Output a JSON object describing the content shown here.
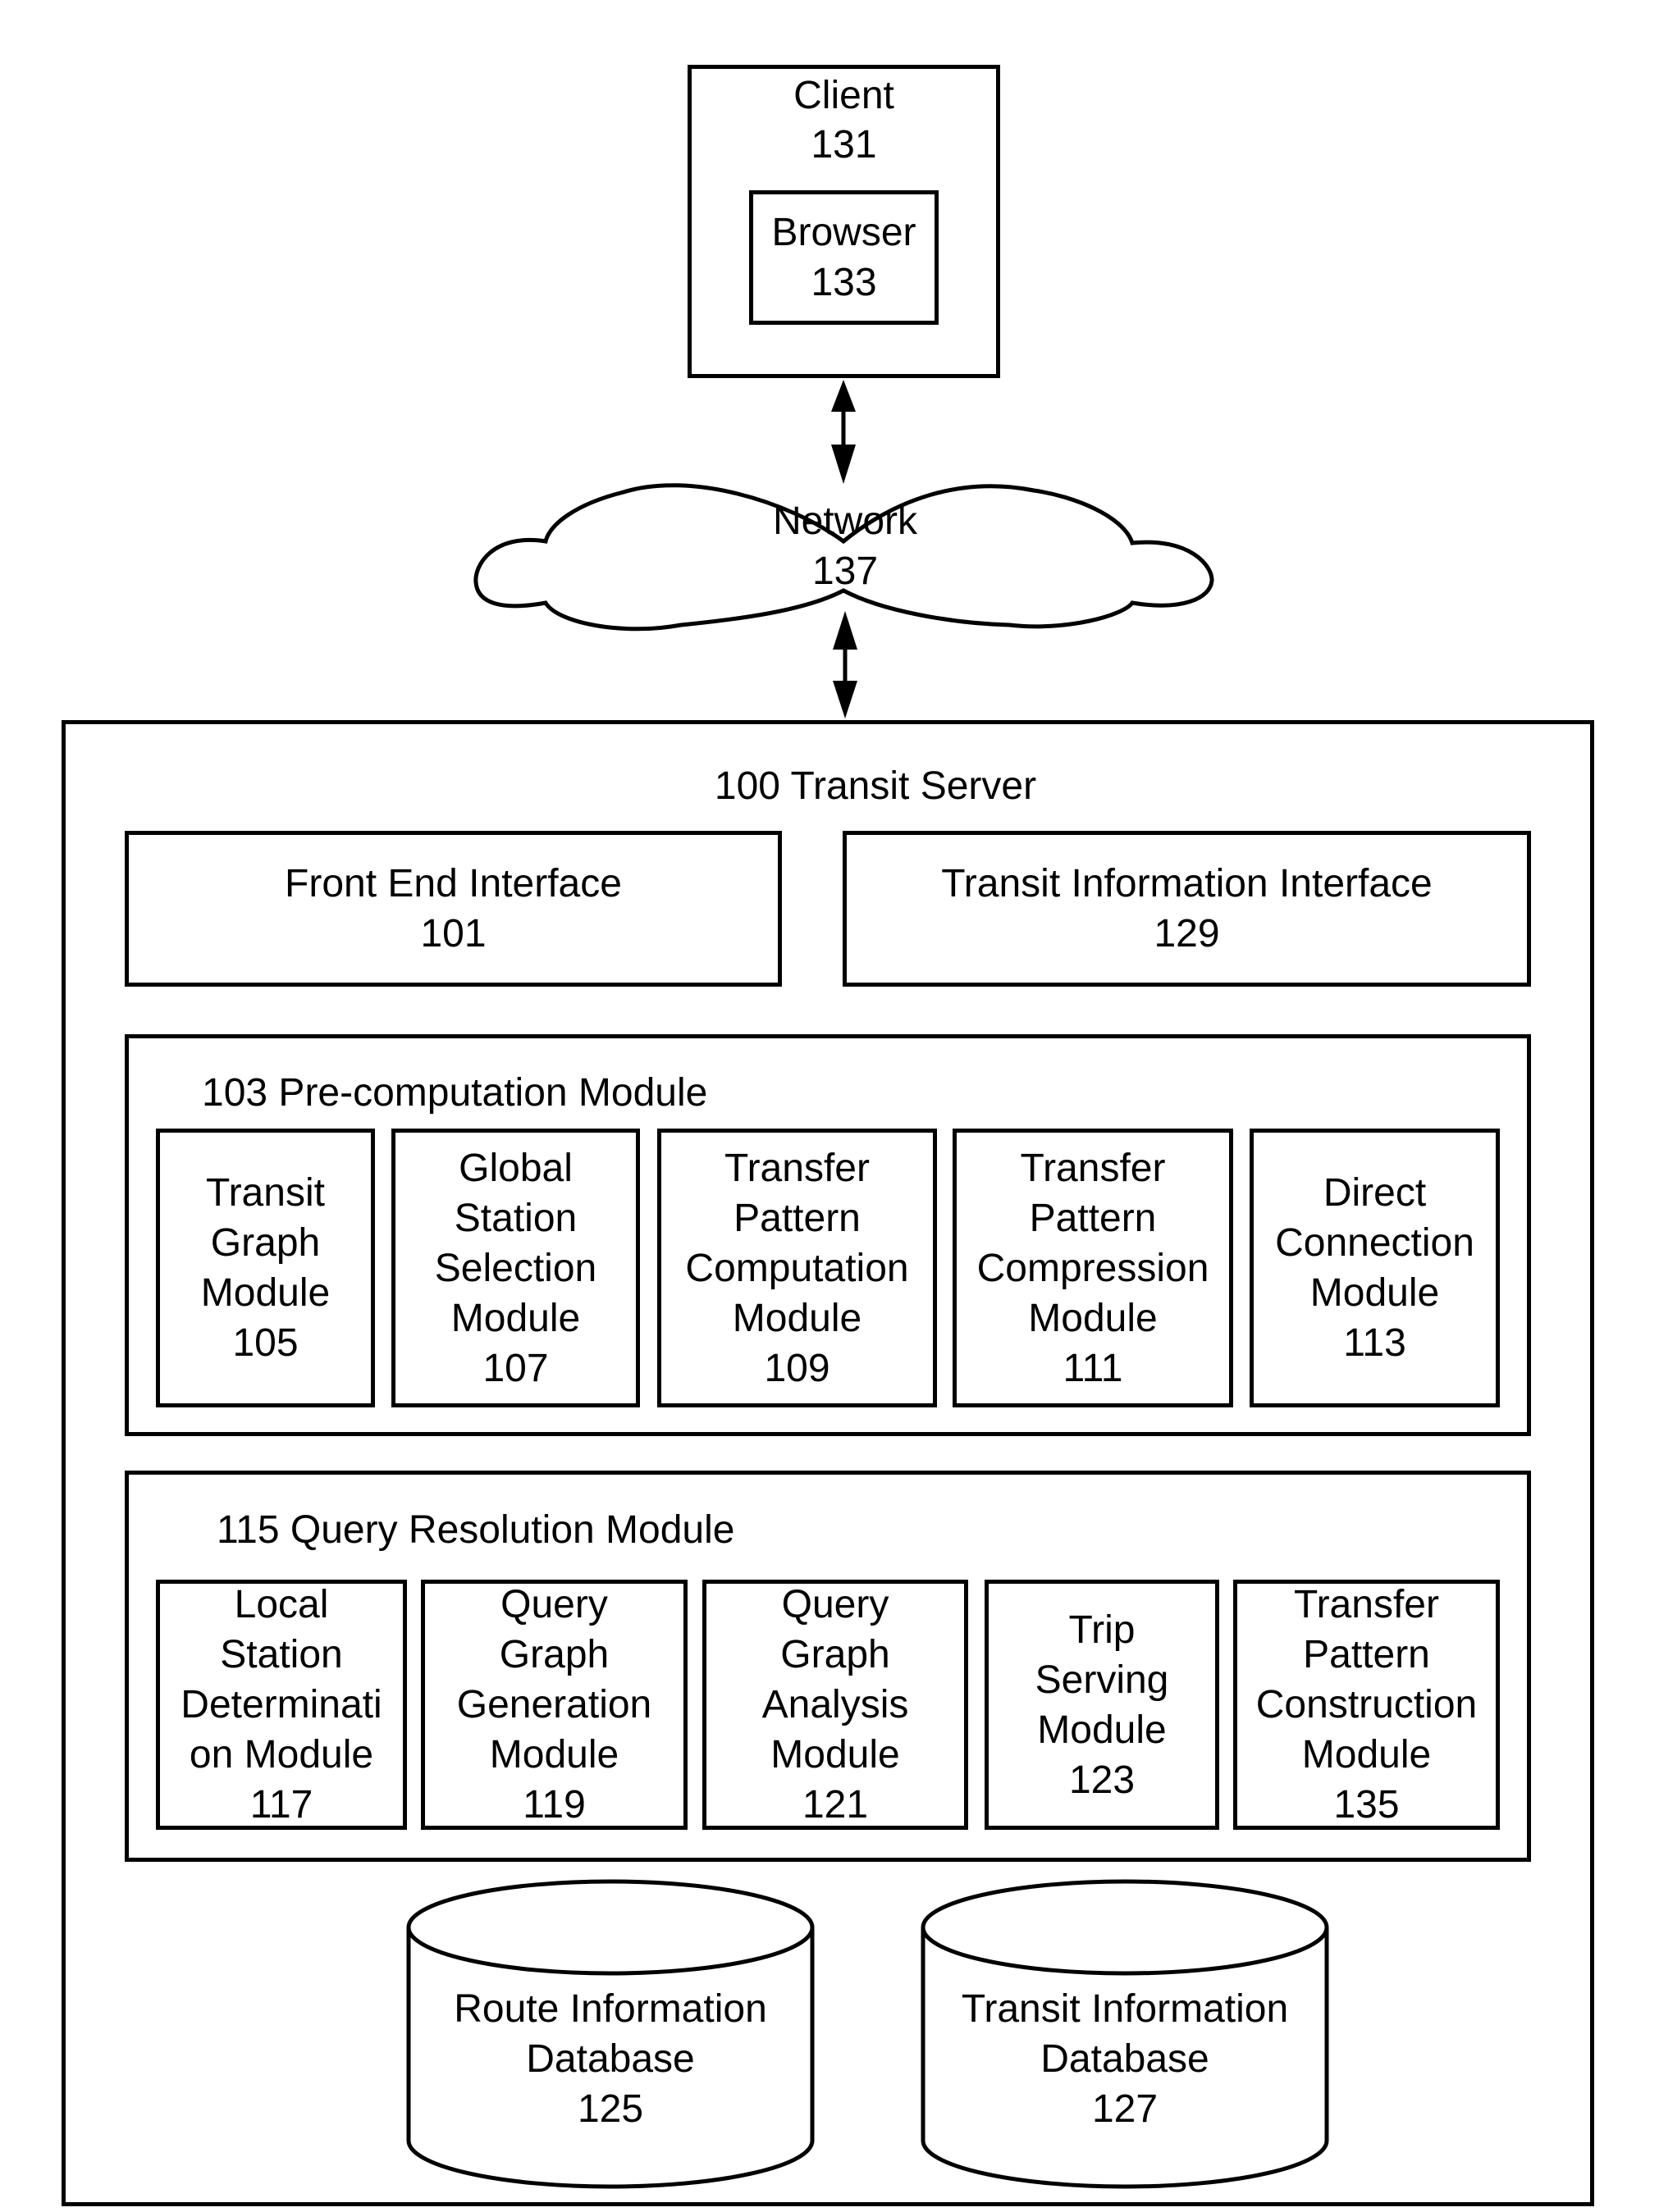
{
  "client": {
    "title": "Client",
    "number": "131"
  },
  "browser": {
    "title": "Browser",
    "number": "133"
  },
  "network": {
    "title": "Network",
    "number": "137"
  },
  "server": {
    "title": "100 Transit Server"
  },
  "front_end": {
    "title": "Front End Interface",
    "number": "101"
  },
  "transit_info_interface": {
    "title": "Transit Information Interface",
    "number": "129"
  },
  "precomputation": {
    "title": "103 Pre-computation Module",
    "modules": [
      {
        "lines": [
          "Transit",
          "Graph",
          "Module"
        ],
        "number": "105"
      },
      {
        "lines": [
          "Global",
          "Station",
          "Selection",
          "Module"
        ],
        "number": "107"
      },
      {
        "lines": [
          "Transfer",
          "Pattern",
          "Computation",
          "Module"
        ],
        "number": "109"
      },
      {
        "lines": [
          "Transfer",
          "Pattern",
          "Compression",
          "Module"
        ],
        "number": "111"
      },
      {
        "lines": [
          "Direct",
          "Connection",
          "Module"
        ],
        "number": "113"
      }
    ]
  },
  "query_resolution": {
    "title": "115 Query Resolution Module",
    "modules": [
      {
        "lines": [
          "Local",
          "Station",
          "Determinati",
          "on Module"
        ],
        "number": "117"
      },
      {
        "lines": [
          "Query",
          "Graph",
          "Generation",
          "Module"
        ],
        "number": "119"
      },
      {
        "lines": [
          "Query",
          "Graph",
          "Analysis",
          "Module"
        ],
        "number": "121"
      },
      {
        "lines": [
          "Trip",
          "Serving",
          "Module"
        ],
        "number": "123"
      },
      {
        "lines": [
          "Transfer",
          "Pattern",
          "Construction",
          "Module"
        ],
        "number": "135"
      }
    ]
  },
  "databases": [
    {
      "lines": [
        "Route Information",
        "Database"
      ],
      "number": "125"
    },
    {
      "lines": [
        "Transit Information",
        "Database"
      ],
      "number": "127"
    }
  ]
}
